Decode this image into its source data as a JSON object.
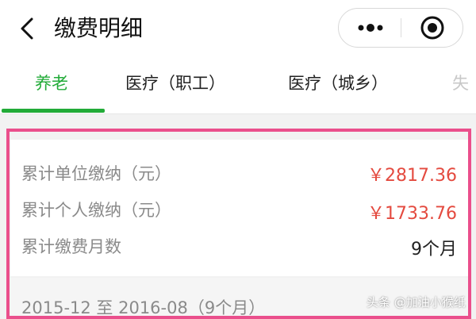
{
  "header": {
    "title": "缴费明细",
    "back_icon": "chevron-left-icon",
    "more_icon": "more-dots-icon",
    "close_icon": "target-circle-icon"
  },
  "tabs": [
    {
      "label": "养老",
      "active": true
    },
    {
      "label": "医疗（职工）",
      "active": false
    },
    {
      "label": "医疗（城乡）",
      "active": false
    },
    {
      "label": "失",
      "active": false
    }
  ],
  "summary": {
    "unit_total": {
      "label": "累计单位缴纳（元）",
      "value": "￥2817.36"
    },
    "personal_total": {
      "label": "累计个人缴纳（元）",
      "value": "￥1733.76"
    },
    "months": {
      "label": "累计缴费月数",
      "value": "9个月"
    }
  },
  "period": {
    "text": "2015-12 至 2016-08（9个月）"
  },
  "watermark": {
    "text": "头条 @加油小猴纸"
  },
  "colors": {
    "accent_green": "#22ab38",
    "amount_red": "#e44a3f",
    "highlight_pink": "#ea4f8c"
  }
}
